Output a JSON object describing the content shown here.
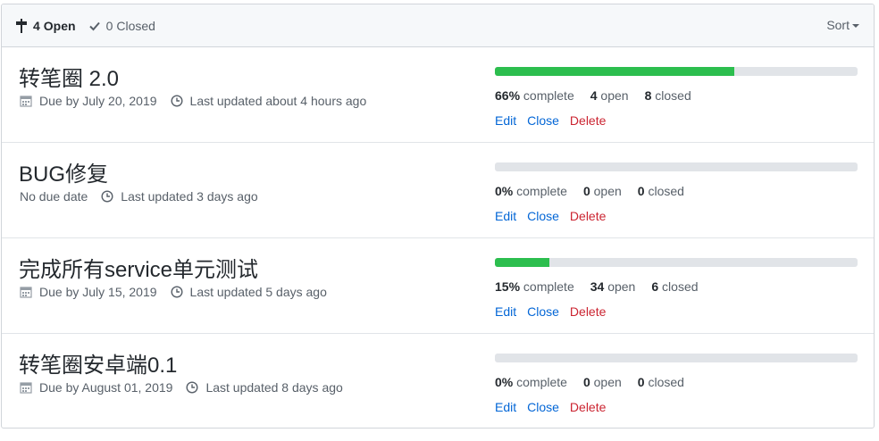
{
  "header": {
    "open_count": "4",
    "open_label": "Open",
    "closed_count": "0",
    "closed_label": "Closed",
    "sort_label": "Sort",
    "open_icon": "milestone-icon",
    "closed_icon": "check-icon"
  },
  "milestones": [
    {
      "title": "转笔圈 2.0",
      "due": "Due by July 20, 2019",
      "updated": "Last updated about 4 hours ago",
      "progress": 0.66,
      "percent": "66%",
      "complete_label": "complete",
      "open": "4",
      "open_label": "open",
      "closed": "8",
      "closed_label": "closed",
      "edit": "Edit",
      "close": "Close",
      "delete": "Delete"
    },
    {
      "title": "BUG修复",
      "due": "No due date",
      "updated": "Last updated 3 days ago",
      "progress": 0,
      "percent": "0%",
      "complete_label": "complete",
      "open": "0",
      "open_label": "open",
      "closed": "0",
      "closed_label": "closed",
      "edit": "Edit",
      "close": "Close",
      "delete": "Delete"
    },
    {
      "title": "完成所有service单元测试",
      "due": "Due by July 15, 2019",
      "updated": "Last updated 5 days ago",
      "progress": 0.15,
      "percent": "15%",
      "complete_label": "complete",
      "open": "34",
      "open_label": "open",
      "closed": "6",
      "closed_label": "closed",
      "edit": "Edit",
      "close": "Close",
      "delete": "Delete"
    },
    {
      "title": "转笔圈安卓端0.1",
      "due": "Due by August 01, 2019",
      "updated": "Last updated 8 days ago",
      "progress": 0,
      "percent": "0%",
      "complete_label": "complete",
      "open": "0",
      "open_label": "open",
      "closed": "0",
      "closed_label": "closed",
      "edit": "Edit",
      "close": "Close",
      "delete": "Delete"
    }
  ],
  "colors": {
    "progress_fill": "#2cbe4e",
    "progress_track": "#e1e4e8",
    "link": "#0366d6",
    "danger": "#cb2431"
  }
}
